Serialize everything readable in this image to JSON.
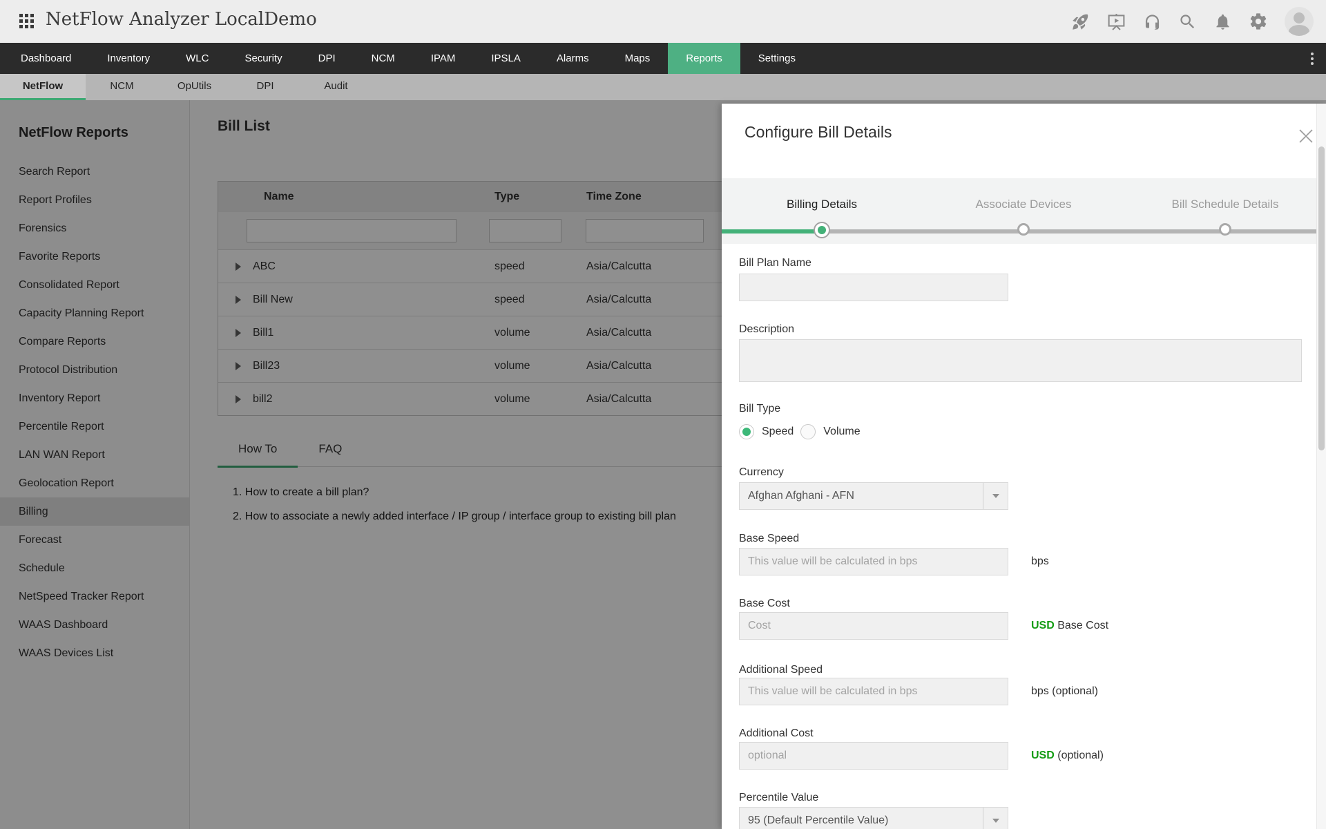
{
  "topbar": {
    "title": "NetFlow Analyzer LocalDemo",
    "icons": [
      "rocket-icon",
      "demo-player-icon",
      "headset-icon",
      "search-icon",
      "bell-icon",
      "gear-icon",
      "avatar"
    ]
  },
  "nav": {
    "items": [
      "Dashboard",
      "Inventory",
      "WLC",
      "Security",
      "DPI",
      "NCM",
      "IPAM",
      "IPSLA",
      "Alarms",
      "Maps",
      "Reports",
      "Settings"
    ],
    "active": "Reports"
  },
  "subnav": {
    "items": [
      "NetFlow",
      "NCM",
      "OpUtils",
      "DPI",
      "Audit"
    ],
    "active": "NetFlow"
  },
  "sidebar": {
    "title": "NetFlow Reports",
    "selected": "Billing",
    "items": [
      {
        "label": "Search Report"
      },
      {
        "label": "Report Profiles"
      },
      {
        "label": "Forensics"
      },
      {
        "label": "Favorite Reports"
      },
      {
        "label": "Consolidated Report"
      },
      {
        "label": "Capacity Planning Report"
      },
      {
        "label": "Compare Reports"
      },
      {
        "label": "Protocol Distribution"
      },
      {
        "label": "Inventory Report"
      },
      {
        "label": "Percentile Report"
      },
      {
        "label": "LAN WAN Report"
      },
      {
        "label": "Geolocation Report"
      },
      {
        "label": "Billing"
      },
      {
        "label": "Forecast"
      },
      {
        "label": "Schedule"
      },
      {
        "label": "NetSpeed Tracker Report"
      },
      {
        "label": "WAAS Dashboard"
      },
      {
        "label": "WAAS Devices List"
      }
    ]
  },
  "main": {
    "title": "Bill List",
    "table": {
      "columns": [
        "Name",
        "Type",
        "Time Zone"
      ],
      "rows": [
        {
          "name": "ABC",
          "type": "speed",
          "timezone": "Asia/Calcutta"
        },
        {
          "name": "Bill New",
          "type": "speed",
          "timezone": "Asia/Calcutta"
        },
        {
          "name": "Bill1",
          "type": "volume",
          "timezone": "Asia/Calcutta"
        },
        {
          "name": "Bill23",
          "type": "volume",
          "timezone": "Asia/Calcutta"
        },
        {
          "name": "bill2",
          "type": "volume",
          "timezone": "Asia/Calcutta"
        }
      ]
    },
    "help": {
      "tabs": [
        "How To",
        "FAQ"
      ],
      "active": "How To",
      "items": [
        "1. How to create a bill plan?",
        "2. How to associate a newly added interface / IP group / interface group to existing bill plan"
      ]
    }
  },
  "panel": {
    "title": "Configure Bill Details",
    "steps": [
      {
        "label": "Billing Details",
        "state": "active"
      },
      {
        "label": "Associate Devices",
        "state": "pending"
      },
      {
        "label": "Bill Schedule Details",
        "state": "pending"
      }
    ],
    "fields": {
      "bill_plan_name": {
        "label": "Bill Plan Name",
        "value": ""
      },
      "description": {
        "label": "Description",
        "value": ""
      },
      "bill_type": {
        "label": "Bill Type",
        "options": [
          "Speed",
          "Volume"
        ],
        "selected": "Speed"
      },
      "currency": {
        "label": "Currency",
        "value": "Afghan Afghani - AFN"
      },
      "base_speed": {
        "label": "Base Speed",
        "placeholder": "This value will be calculated in bps",
        "unit": "bps"
      },
      "base_cost": {
        "label": "Base Cost",
        "placeholder": "Cost",
        "unit_currency": "USD",
        "unit_text": "Base Cost"
      },
      "additional_speed": {
        "label": "Additional Speed",
        "placeholder": "This value will be calculated in bps",
        "unit": "bps (optional)"
      },
      "additional_cost": {
        "label": "Additional Cost",
        "placeholder": "optional",
        "unit_currency": "USD",
        "unit_text": "(optional)"
      },
      "percentile_value": {
        "label": "Percentile Value",
        "value": "95 (Default Percentile Value)"
      }
    }
  },
  "colors": {
    "accent_green": "#4eb083",
    "step_green": "#43b178",
    "usd_green": "#149b14",
    "nav_dark": "#2b2b2b"
  }
}
